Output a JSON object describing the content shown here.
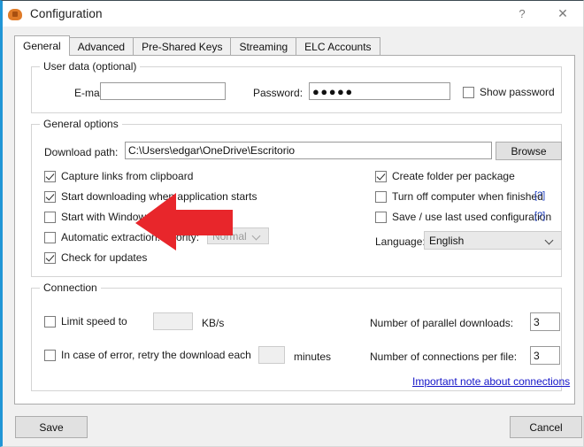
{
  "window": {
    "title": "Configuration",
    "app_icon": "app-cloud-icon",
    "help_button": "?",
    "close_button": "✕",
    "accent_color": "#2196d6"
  },
  "tabs": [
    {
      "label": "General",
      "active": true
    },
    {
      "label": "Advanced",
      "active": false
    },
    {
      "label": "Pre-Shared Keys",
      "active": false
    },
    {
      "label": "Streaming",
      "active": false
    },
    {
      "label": "ELC Accounts",
      "active": false
    }
  ],
  "user_data": {
    "legend": "User data (optional)",
    "email_label": "E-mail:",
    "email_value": "",
    "email_placeholder": "",
    "password_label": "Password:",
    "password_value": "●●●●●",
    "show_password_label": "Show password",
    "show_password_checked": false
  },
  "general_options": {
    "legend": "General options",
    "download_path_label": "Download path:",
    "download_path_value": "C:\\Users\\edgar\\OneDrive\\Escritorio",
    "browse_label": "Browse",
    "left_checkboxes": [
      {
        "label": "Capture links from clipboard",
        "checked": true
      },
      {
        "label": "Start downloading when application starts",
        "checked": true
      },
      {
        "label": "Start with Windows",
        "checked": false
      },
      {
        "label": "Automatic extraction. Priority:",
        "checked": false
      },
      {
        "label": "Check for updates",
        "checked": true
      }
    ],
    "priority_value": "Normal",
    "priority_enabled": false,
    "right_checkboxes": [
      {
        "label": "Create folder per package",
        "checked": true,
        "help": ""
      },
      {
        "label": "Turn off computer when finished",
        "checked": false,
        "help": "[?]"
      },
      {
        "label": "Save / use last used configuration",
        "checked": false,
        "help": "[?]"
      }
    ],
    "language_label": "Language:",
    "language_value": "English"
  },
  "connection": {
    "legend": "Connection",
    "limit_speed_label": "Limit speed to",
    "limit_speed_checked": false,
    "limit_speed_value": "",
    "kbs_label": "KB/s",
    "retry_label": "In case of error, retry the download each",
    "retry_checked": false,
    "retry_value": "",
    "minutes_label": "minutes",
    "parallel_downloads_label": "Number of parallel downloads:",
    "parallel_downloads_value": "3",
    "connections_per_file_label": "Number of connections per file:",
    "connections_per_file_value": "3",
    "note_link": "Important note about connections"
  },
  "footer": {
    "save_label": "Save",
    "cancel_label": "Cancel"
  },
  "annotation": {
    "arrow_color": "#e8262b",
    "arrow_direction": "left"
  }
}
